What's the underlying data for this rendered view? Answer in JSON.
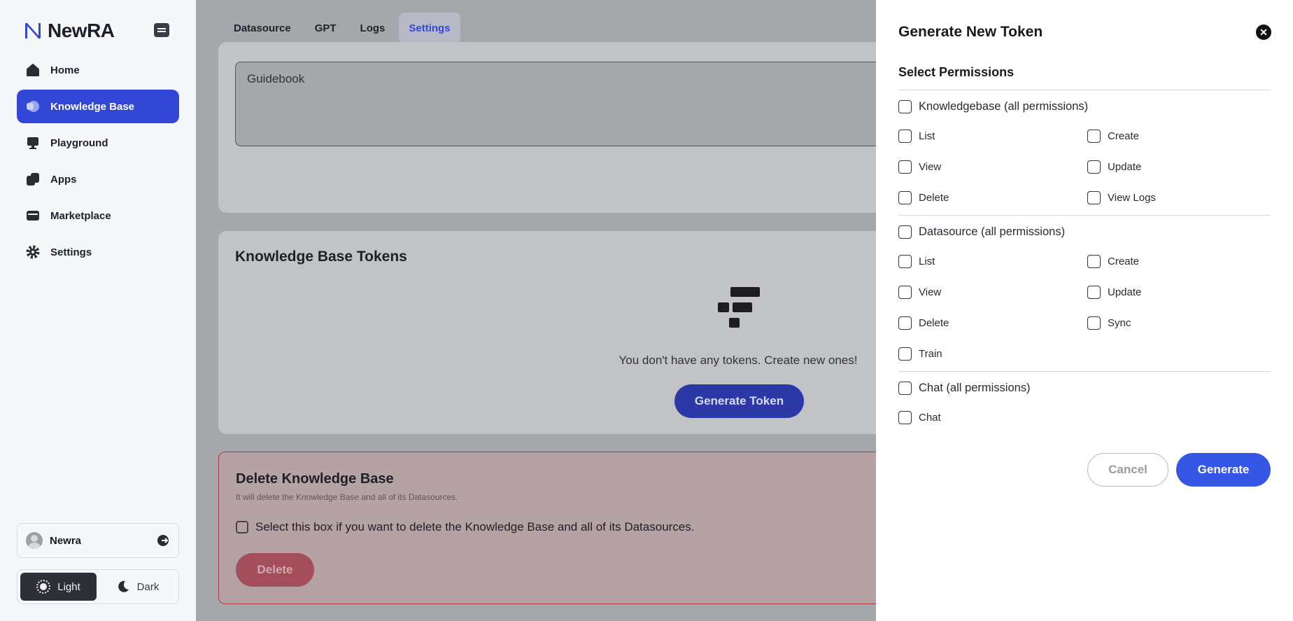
{
  "app": {
    "name": "NewRA"
  },
  "sidebar": {
    "items": [
      {
        "label": "Home",
        "icon": "home-icon"
      },
      {
        "label": "Knowledge Base",
        "icon": "knowledge-base-icon",
        "active": true
      },
      {
        "label": "Playground",
        "icon": "playground-icon"
      },
      {
        "label": "Apps",
        "icon": "apps-icon"
      },
      {
        "label": "Marketplace",
        "icon": "marketplace-icon"
      },
      {
        "label": "Settings",
        "icon": "gear-icon"
      }
    ],
    "user": {
      "name": "Newra"
    },
    "theme": {
      "light_label": "Light",
      "dark_label": "Dark",
      "selected": "Light"
    }
  },
  "tabs": [
    {
      "label": "Datasource"
    },
    {
      "label": "GPT"
    },
    {
      "label": "Logs"
    },
    {
      "label": "Settings",
      "active": true
    }
  ],
  "main": {
    "description_value": "Guidebook",
    "tokens": {
      "title": "Knowledge Base Tokens",
      "empty_text": "You don't have any tokens. Create new ones!",
      "generate_label": "Generate Token"
    },
    "danger": {
      "title": "Delete Knowledge Base",
      "subtitle": "It will delete the Knowledge Base and all of its Datasources.",
      "confirm_label": "Select this box if you want to delete the Knowledge Base and all of its Datasources.",
      "delete_label": "Delete"
    }
  },
  "panel": {
    "title": "Generate New Token",
    "section_title": "Select Permissions",
    "knowledgebase": {
      "group_label": "Knowledgebase (all permissions)",
      "list": "List",
      "create": "Create",
      "view": "View",
      "update": "Update",
      "delete": "Delete",
      "view_logs": "View Logs"
    },
    "datasource": {
      "group_label": "Datasource (all permissions)",
      "list": "List",
      "create": "Create",
      "view": "View",
      "update": "Update",
      "delete": "Delete",
      "sync": "Sync",
      "train": "Train"
    },
    "chat": {
      "group_label": "Chat (all permissions)",
      "chat": "Chat"
    },
    "cancel_label": "Cancel",
    "generate_label": "Generate"
  },
  "colors": {
    "accent": "#3347d6",
    "primary_button": "#3656e6",
    "danger_border": "#b23a44"
  }
}
